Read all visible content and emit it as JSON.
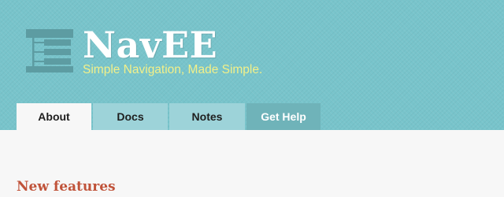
{
  "header": {
    "title": "NavEE",
    "tagline": "Simple Navigation, Made Simple.",
    "logo_icon": "nav-tree-icon"
  },
  "tabs": [
    {
      "label": "About",
      "active": true
    },
    {
      "label": "Docs",
      "active": false
    },
    {
      "label": "Notes",
      "active": false
    },
    {
      "label": "Get Help",
      "active": false
    }
  ],
  "main": {
    "section_heading": "New features"
  },
  "colors": {
    "header_bg": "#78c4cb",
    "tagline": "#f2f089",
    "heading_accent": "#c0533a",
    "tab_bg": "#9dd3d9",
    "help_tab_bg": "#6fb3b9"
  }
}
